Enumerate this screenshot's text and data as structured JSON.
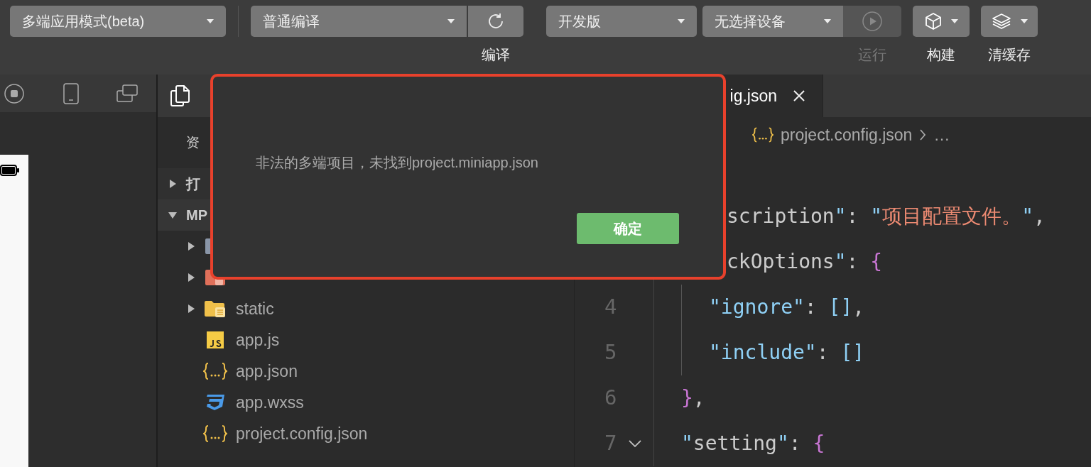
{
  "toolbar": {
    "mode_select": "多端应用模式(beta)",
    "compile_select": "普通编译",
    "compile_label": "编译",
    "version_select": "开发版",
    "device_select": "无选择设备",
    "run": {
      "label": "运行",
      "disabled": true
    },
    "build_label": "构建",
    "clear_cache_label": "清缓存"
  },
  "explorer": {
    "title": "资",
    "sections": [
      {
        "label": "打",
        "expanded": false
      },
      {
        "label": "MP",
        "expanded": true
      }
    ],
    "items": [
      {
        "kind": "folder",
        "expanded": false
      },
      {
        "kind": "pages",
        "expanded": false
      },
      {
        "kind": "static",
        "label": "static",
        "expanded": false
      },
      {
        "kind": "js",
        "label": "app.js"
      },
      {
        "kind": "json",
        "label": "app.json"
      },
      {
        "kind": "css",
        "label": "app.wxss"
      },
      {
        "kind": "json",
        "label": "project.config.json"
      }
    ]
  },
  "editor": {
    "tab": "ig.json",
    "breadcrumb": [
      "project.config.json",
      "…"
    ],
    "lines": [
      {
        "kind": "clipped",
        "tokens": [
          {
            "text": "scription",
            "kind": "plain"
          },
          {
            "text": "\"",
            "kind": "quote"
          },
          {
            "text": ": ",
            "kind": "punct"
          },
          {
            "text": "\"",
            "kind": "quote"
          },
          {
            "text": "项目配置文件。",
            "kind": "string"
          },
          {
            "text": "\"",
            "kind": "quote"
          },
          {
            "text": ",",
            "kind": "punct"
          }
        ]
      },
      {
        "kind": "clipped",
        "tokens": [
          {
            "text": "ckOptions",
            "kind": "plain"
          },
          {
            "text": "\"",
            "kind": "quote"
          },
          {
            "text": ": ",
            "kind": "punct"
          },
          {
            "text": "{",
            "kind": "brace"
          }
        ]
      },
      {
        "kind": "nested",
        "number": "4",
        "fold": false,
        "tokens": [
          {
            "text": "\"ignore\"",
            "kind": "key"
          },
          {
            "text": ": ",
            "kind": "punct"
          },
          {
            "text": "[]",
            "kind": "key"
          },
          {
            "text": ",",
            "kind": "punct"
          }
        ]
      },
      {
        "kind": "nested",
        "number": "5",
        "fold": false,
        "tokens": [
          {
            "text": "\"include\"",
            "kind": "key"
          },
          {
            "text": ": ",
            "kind": "punct"
          },
          {
            "text": "[]",
            "kind": "key"
          }
        ]
      },
      {
        "kind": "top",
        "number": "6",
        "fold": false,
        "tokens": [
          {
            "text": "}",
            "kind": "brace"
          },
          {
            "text": ",",
            "kind": "punct"
          }
        ]
      },
      {
        "kind": "top",
        "number": "7",
        "fold": true,
        "tokens": [
          {
            "text": "\"",
            "kind": "quote"
          },
          {
            "text": "setting",
            "kind": "plain"
          },
          {
            "text": "\"",
            "kind": "quote"
          },
          {
            "text": ": ",
            "kind": "punct"
          },
          {
            "text": "{",
            "kind": "brace"
          }
        ]
      }
    ]
  },
  "dialog": {
    "message": "非法的多端项目，未找到project.miniapp.json",
    "button": "确定"
  }
}
